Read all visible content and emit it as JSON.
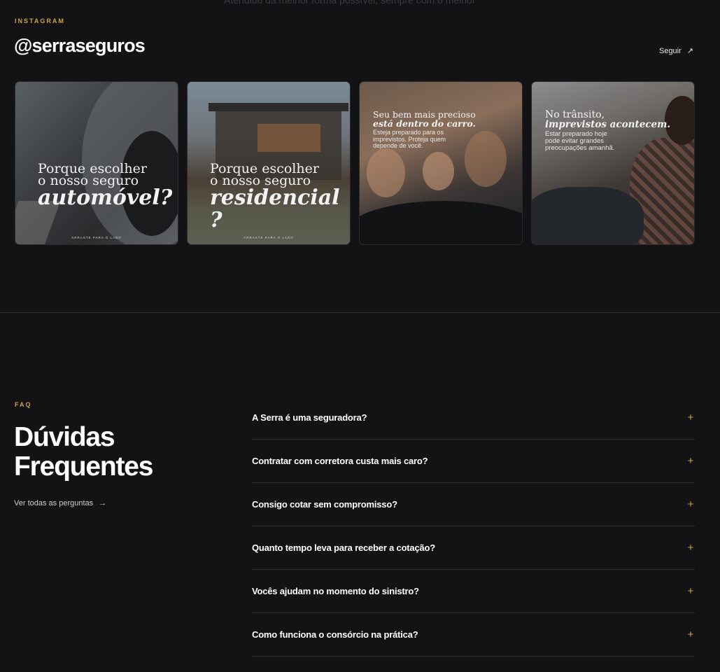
{
  "top_ghost": "Atendido da melhor forma possível, sempre com o melhor",
  "instagram": {
    "eyebrow": "INSTAGRAM",
    "handle": "@serraseguros",
    "follow_label": "Seguir",
    "posts": [
      {
        "line1a": "Porque escolher",
        "line1b": "o nosso seguro",
        "line2": "automóvel?",
        "foot": "ARRASTE PARA O LADO"
      },
      {
        "line1a": "Porque escolher",
        "line1b": "o nosso seguro",
        "line2": "residencial ?",
        "foot": "ARRASTE PARA O LADO"
      },
      {
        "a": "Seu bem mais precioso",
        "b": "está dentro do carro.",
        "c1": "Esteja preparado para os",
        "c2": "imprevistos. Proteja quem",
        "c3": "depende de você."
      },
      {
        "a": "No trânsito,",
        "b": "imprevistos acontecem.",
        "c1": "Estar preparado hoje",
        "c2": "pode evitar grandes",
        "c3": "preocupações amanhã."
      }
    ]
  },
  "faq": {
    "eyebrow": "FAQ",
    "title_line1": "Dúvidas",
    "title_line2": "Frequentes",
    "all_label": "Ver todas as perguntas",
    "items": [
      "A Serra é uma seguradora?",
      "Contratar com corretora custa mais caro?",
      "Consigo cotar sem compromisso?",
      "Quanto tempo leva para receber a cotação?",
      "Vocês ajudam no momento do sinistro?",
      "Como funciona o consórcio na prática?"
    ]
  },
  "colors": {
    "accent": "#c9a34a",
    "background": "#131316",
    "divider": "#2a2a2e"
  },
  "icons": {
    "follow": "arrow-up-right-icon",
    "all": "arrow-right-icon",
    "expand": "plus-icon"
  }
}
